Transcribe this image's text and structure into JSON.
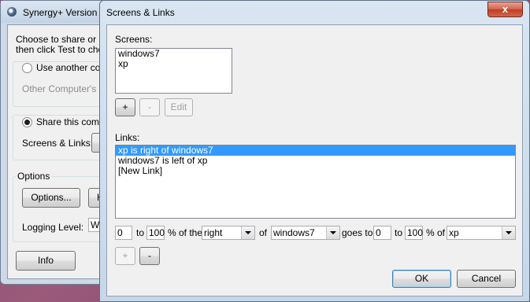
{
  "background_window": {
    "title": "Synergy+ Version",
    "intro_line1": "Choose to share or use",
    "intro_line2": "then click Test to chec",
    "use_another_label": "Use another comp",
    "other_host_placeholder": "Other Computer's Ho",
    "share_label": "Share this compu",
    "screens_links_label": "Screens & Links:",
    "options_group_label": "Options",
    "options_button": "Options...",
    "hotkeys_button_partial": "H",
    "logging_level_label": "Logging Level:",
    "logging_level_value_partial": "W",
    "info_button": "Info"
  },
  "dialog": {
    "title": "Screens & Links",
    "close_glyph": "x",
    "screens_label": "Screens:",
    "screens": [
      "windows7",
      "xp"
    ],
    "screens_add": "+",
    "screens_remove": "-",
    "screens_edit": "Edit",
    "links_label": "Links:",
    "links": [
      {
        "text": "xp is right of windows7",
        "selected": true
      },
      {
        "text": "windows7 is left of xp",
        "selected": false
      },
      {
        "text": "[New Link]",
        "selected": false
      }
    ],
    "link_editor": {
      "from_start": "0",
      "to_word_1": "to",
      "from_end": "100",
      "pct_of_the": "% of the",
      "direction": "right",
      "of_word": "of",
      "source_screen": "windows7",
      "goes_to": "goes to",
      "dest_start": "0",
      "to_word_2": "to",
      "dest_end": "100",
      "pct_of": "% of",
      "dest_screen": "xp"
    },
    "links_add": "+",
    "links_remove": "-",
    "ok": "OK",
    "cancel": "Cancel"
  }
}
